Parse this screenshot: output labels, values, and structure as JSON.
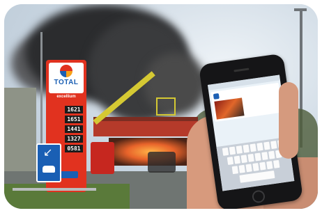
{
  "sign": {
    "brand": "TOTAL",
    "sub_brand": "excellium",
    "prices": [
      {
        "label": "",
        "value": "1621"
      },
      {
        "label": "",
        "value": "1651"
      },
      {
        "label": "",
        "value": "1441"
      },
      {
        "label": "",
        "value": "1327"
      },
      {
        "label": "",
        "value": "0581"
      }
    ]
  },
  "phone": {
    "post_author": "",
    "post_text": ""
  },
  "colors": {
    "sign_red": "#e1321f",
    "brand_blue": "#1a5fb4",
    "smoke": "#2b2c2e"
  },
  "icons": [
    "total-logo-icon",
    "road-arrow-icon",
    "car-icon"
  ]
}
